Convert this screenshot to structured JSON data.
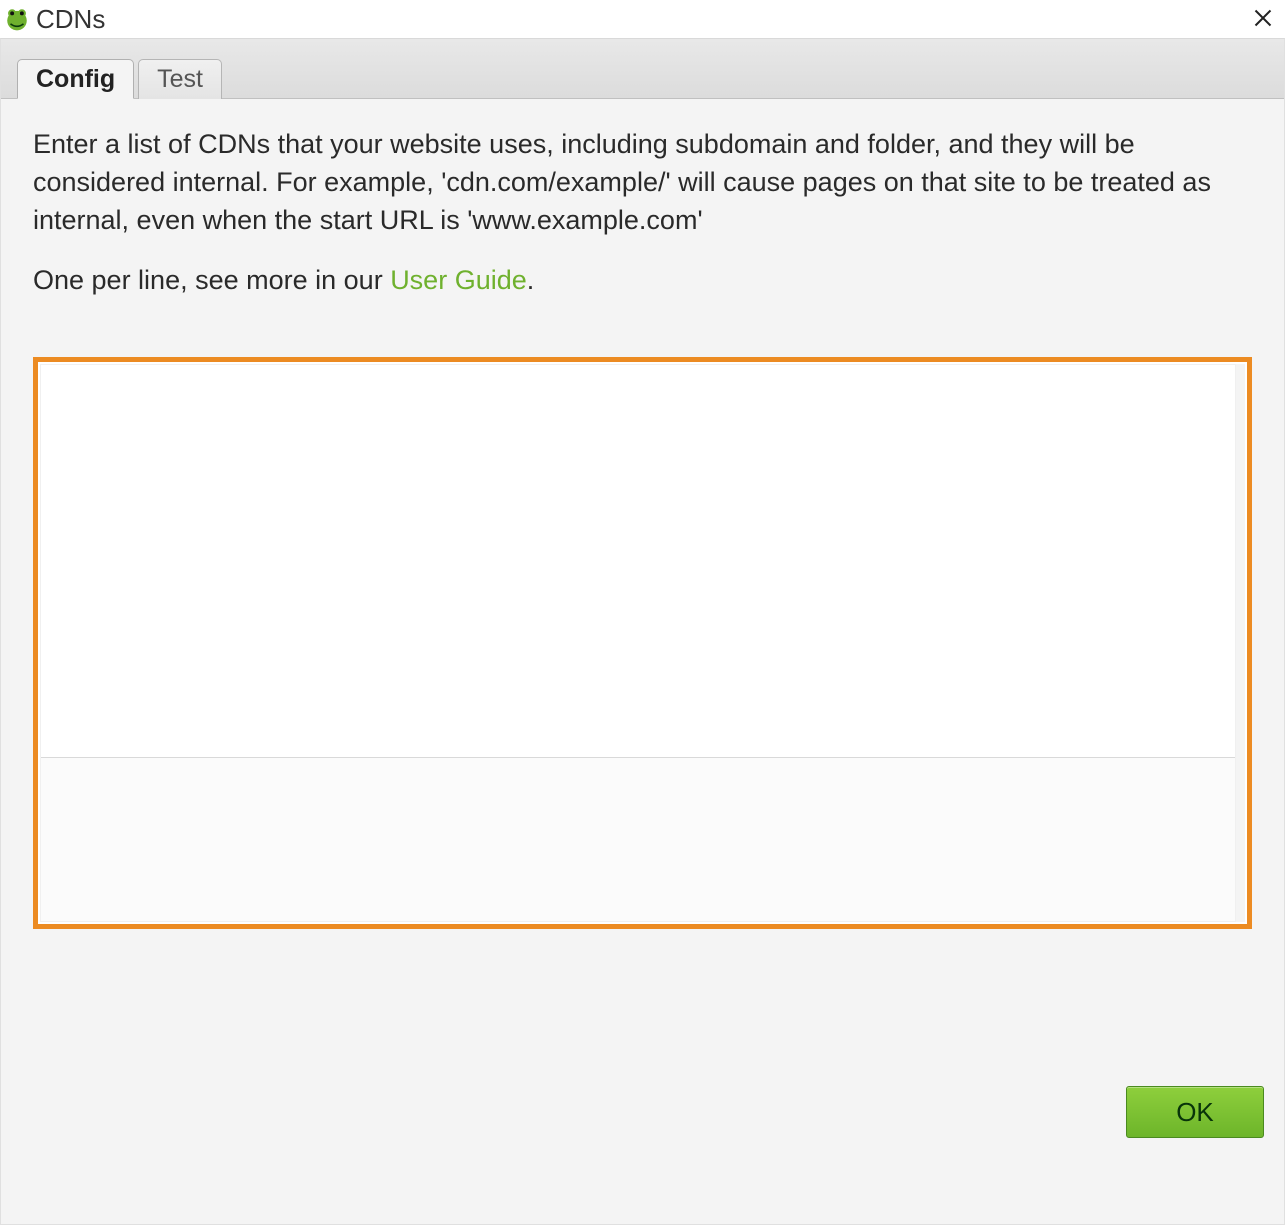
{
  "window": {
    "title": "CDNs"
  },
  "tabs": [
    {
      "label": "Config",
      "active": true
    },
    {
      "label": "Test",
      "active": false
    }
  ],
  "instructions": {
    "main": "Enter a list of CDNs that your website uses, including subdomain and folder, and they will be considered internal. For example, 'cdn.com/example/' will cause pages on that site to be treated as internal, even when the start URL is 'www.example.com'",
    "secondary_prefix": "One per line, see more in our ",
    "link_text": "User Guide",
    "secondary_suffix": "."
  },
  "cdn_textarea": {
    "value": ""
  },
  "buttons": {
    "ok": "OK"
  },
  "colors": {
    "highlight_border": "#ec8b22",
    "link": "#6fb12e",
    "ok_bg_top": "#8ecf3c",
    "ok_bg_bottom": "#6db52a"
  }
}
